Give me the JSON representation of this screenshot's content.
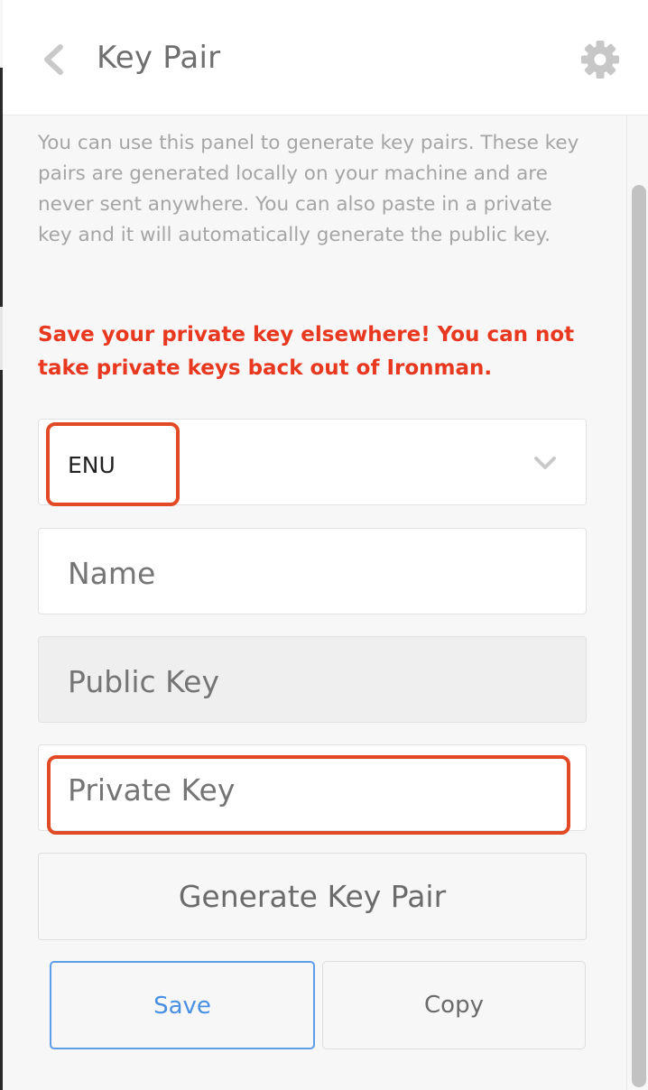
{
  "header": {
    "title": "Key Pair",
    "back_icon": "chevron-left-icon",
    "settings_icon": "gear-icon"
  },
  "panel": {
    "description": "You can use this panel to generate key pairs. These key pairs are generated locally on your machine and are never sent anywhere. You can also paste in a private key and it will automatically generate the public key.",
    "warning": "Save your private key elsewhere! You can not take private keys back out of Ironman."
  },
  "form": {
    "network_select": {
      "value": "ENU"
    },
    "name_placeholder": "Name",
    "public_key_placeholder": "Public Key",
    "private_key_placeholder": "Private Key"
  },
  "buttons": {
    "generate_label": "Generate Key Pair",
    "save_label": "Save",
    "copy_label": "Copy"
  },
  "colors": {
    "warning": "#e8381f",
    "highlight": "#e24a25",
    "primary": "#4a90e2"
  }
}
